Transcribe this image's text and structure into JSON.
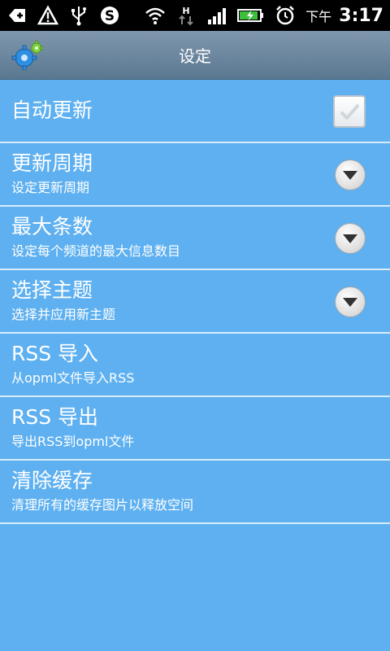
{
  "status_bar": {
    "ampm": "下午",
    "time": "3:17",
    "icons": [
      "usb-debug-icon",
      "warning-icon",
      "usb-icon",
      "skype-icon",
      "wifi-icon",
      "hspa-data-icon",
      "signal-icon",
      "battery-charging-icon",
      "alarm-icon"
    ]
  },
  "header": {
    "title": "设定",
    "logo": "gear-icon"
  },
  "settings": [
    {
      "title": "自动更新",
      "control": "checkbox",
      "checked": true
    },
    {
      "title": "更新周期",
      "subtitle": "设定更新周期",
      "control": "dropdown"
    },
    {
      "title": "最大条数",
      "subtitle": "设定每个频道的最大信息数目",
      "control": "dropdown"
    },
    {
      "title": "选择主题",
      "subtitle": "选择并应用新主题",
      "control": "dropdown"
    },
    {
      "title": "RSS 导入",
      "subtitle": "从opml文件导入RSS"
    },
    {
      "title": "RSS 导出",
      "subtitle": "导出RSS到opml文件"
    },
    {
      "title": "清除缓存",
      "subtitle": "清理所有的缓存图片以释放空间"
    }
  ]
}
